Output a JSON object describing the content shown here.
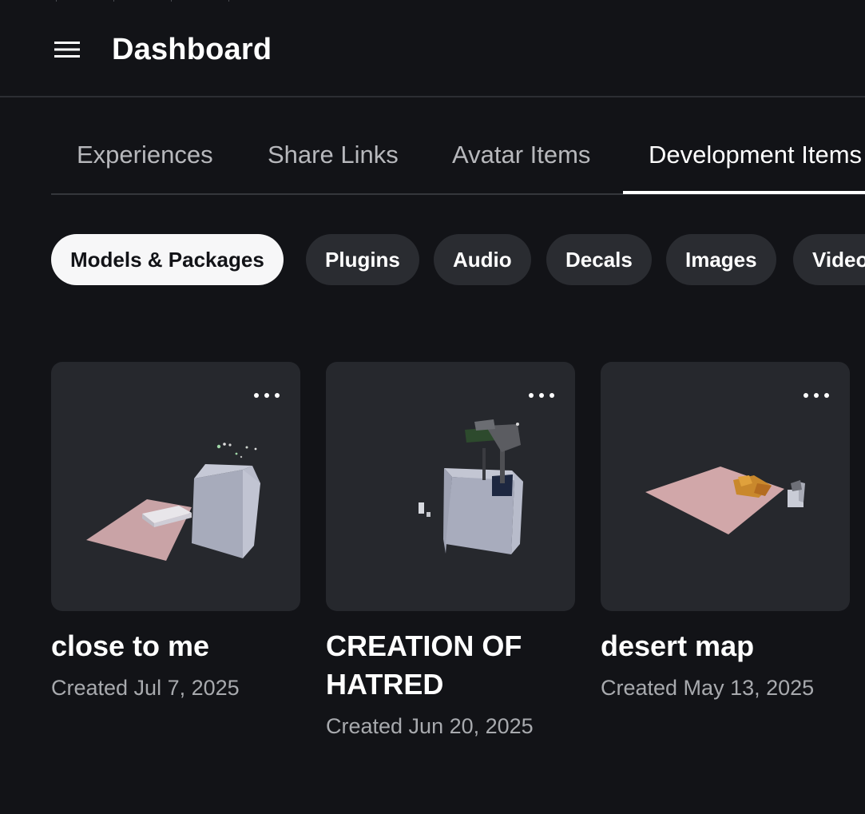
{
  "header": {
    "title": "Dashboard"
  },
  "tabs": [
    {
      "label": "Experiences"
    },
    {
      "label": "Share Links"
    },
    {
      "label": "Avatar Items"
    },
    {
      "label": "Development Items",
      "active": true
    }
  ],
  "filters": [
    {
      "label": "Models & Packages",
      "active": true
    },
    {
      "label": "Plugins"
    },
    {
      "label": "Audio"
    },
    {
      "label": "Decals"
    },
    {
      "label": "Images"
    },
    {
      "label": "Videos"
    }
  ],
  "items": [
    {
      "name": "close to me",
      "created": "Created Jul 7, 2025"
    },
    {
      "name": "CREATION OF HATRED",
      "created": "Created Jun 20, 2025"
    },
    {
      "name": "desert map",
      "created": "Created May 13, 2025"
    }
  ],
  "icons": {
    "menu": "hamburger-menu-icon",
    "more": "more-horizontal-icon"
  },
  "colors": {
    "background": "#121317",
    "card": "#26282d",
    "chip": "#2a2c31",
    "chip_active": "#f7f7f8"
  }
}
